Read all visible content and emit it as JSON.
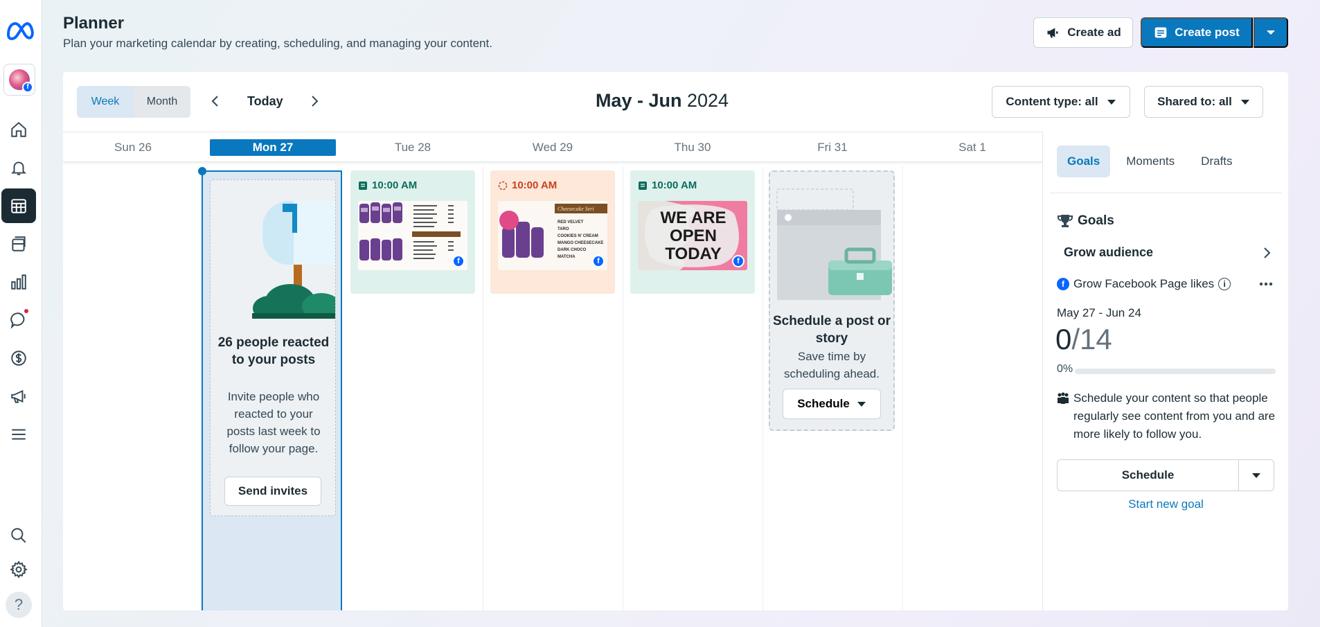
{
  "header": {
    "title": "Planner",
    "subtitle": "Plan your marketing calendar by creating, scheduling, and managing your content.",
    "create_ad_label": "Create ad",
    "create_post_label": "Create post"
  },
  "rail": {
    "icons": [
      "meta-logo-icon",
      "home-icon",
      "bell-icon",
      "calendar-icon",
      "content-icon",
      "insights-icon",
      "inbox-icon",
      "monetization-icon",
      "ads-icon",
      "menu-icon",
      "search-icon",
      "settings-icon",
      "help-icon"
    ],
    "help_label": "?"
  },
  "toolbar": {
    "view_week": "Week",
    "view_month": "Month",
    "selected_view": "Week",
    "today_label": "Today",
    "range_month": "May - Jun",
    "range_year": "2024",
    "content_type_filter": "Content type: all",
    "shared_to_filter": "Shared to: all"
  },
  "calendar": {
    "days": [
      "Sun 26",
      "Mon 27",
      "Tue 28",
      "Wed 29",
      "Thu 30",
      "Fri 31",
      "Sat 1"
    ],
    "today_index": 1,
    "insight": {
      "title": "26 people reacted to your posts",
      "body": "Invite people who reacted to your posts last week to follow your page.",
      "button": "Send invites"
    },
    "posts": [
      {
        "day": "Tue 28",
        "time": "10:00 AM",
        "status": "scheduled",
        "thumb": "menu-price-list",
        "color": "#dff1ec"
      },
      {
        "day": "Wed 29",
        "time": "10:00 AM",
        "status": "processing",
        "thumb": "cheesecake-series",
        "color": "#fde8d9",
        "thumb_text": {
          "heading": "Cheesecake Seri",
          "items": [
            "RED VELVET",
            "TARO",
            "COOKIES N' CREAM",
            "MANGO CHEESECAKE",
            "DARK CHOCO",
            "MATCHA"
          ]
        }
      },
      {
        "day": "Thu 30",
        "time": "10:00 AM",
        "status": "scheduled",
        "thumb": "we-are-open-today",
        "color": "#dff1ec",
        "thumb_text": {
          "lines": [
            "WE ARE",
            "OPEN",
            "TODAY"
          ]
        }
      }
    ],
    "schedule_prompt": {
      "title": "Schedule a post or story",
      "body": "Save time by scheduling ahead.",
      "button": "Schedule"
    }
  },
  "sidebar": {
    "tabs": [
      "Goals",
      "Moments",
      "Drafts"
    ],
    "active_tab": "Goals",
    "goals_heading": "Goals",
    "goal_name": "Grow audience",
    "metric_label": "Grow Facebook Page likes",
    "date_range": "May 27 - Jun 24",
    "current": "0",
    "target": "/14",
    "progress_pct": "0%",
    "progress_value": 0,
    "tip": "Schedule your content so that people regularly see content from you and are more likely to follow you.",
    "schedule_button": "Schedule",
    "new_goal_link": "Start new goal"
  },
  "colors": {
    "accent": "#0a78be",
    "active_rail": "#1c2b33",
    "facebook": "#0866ff",
    "notification": "#e41e3f"
  }
}
